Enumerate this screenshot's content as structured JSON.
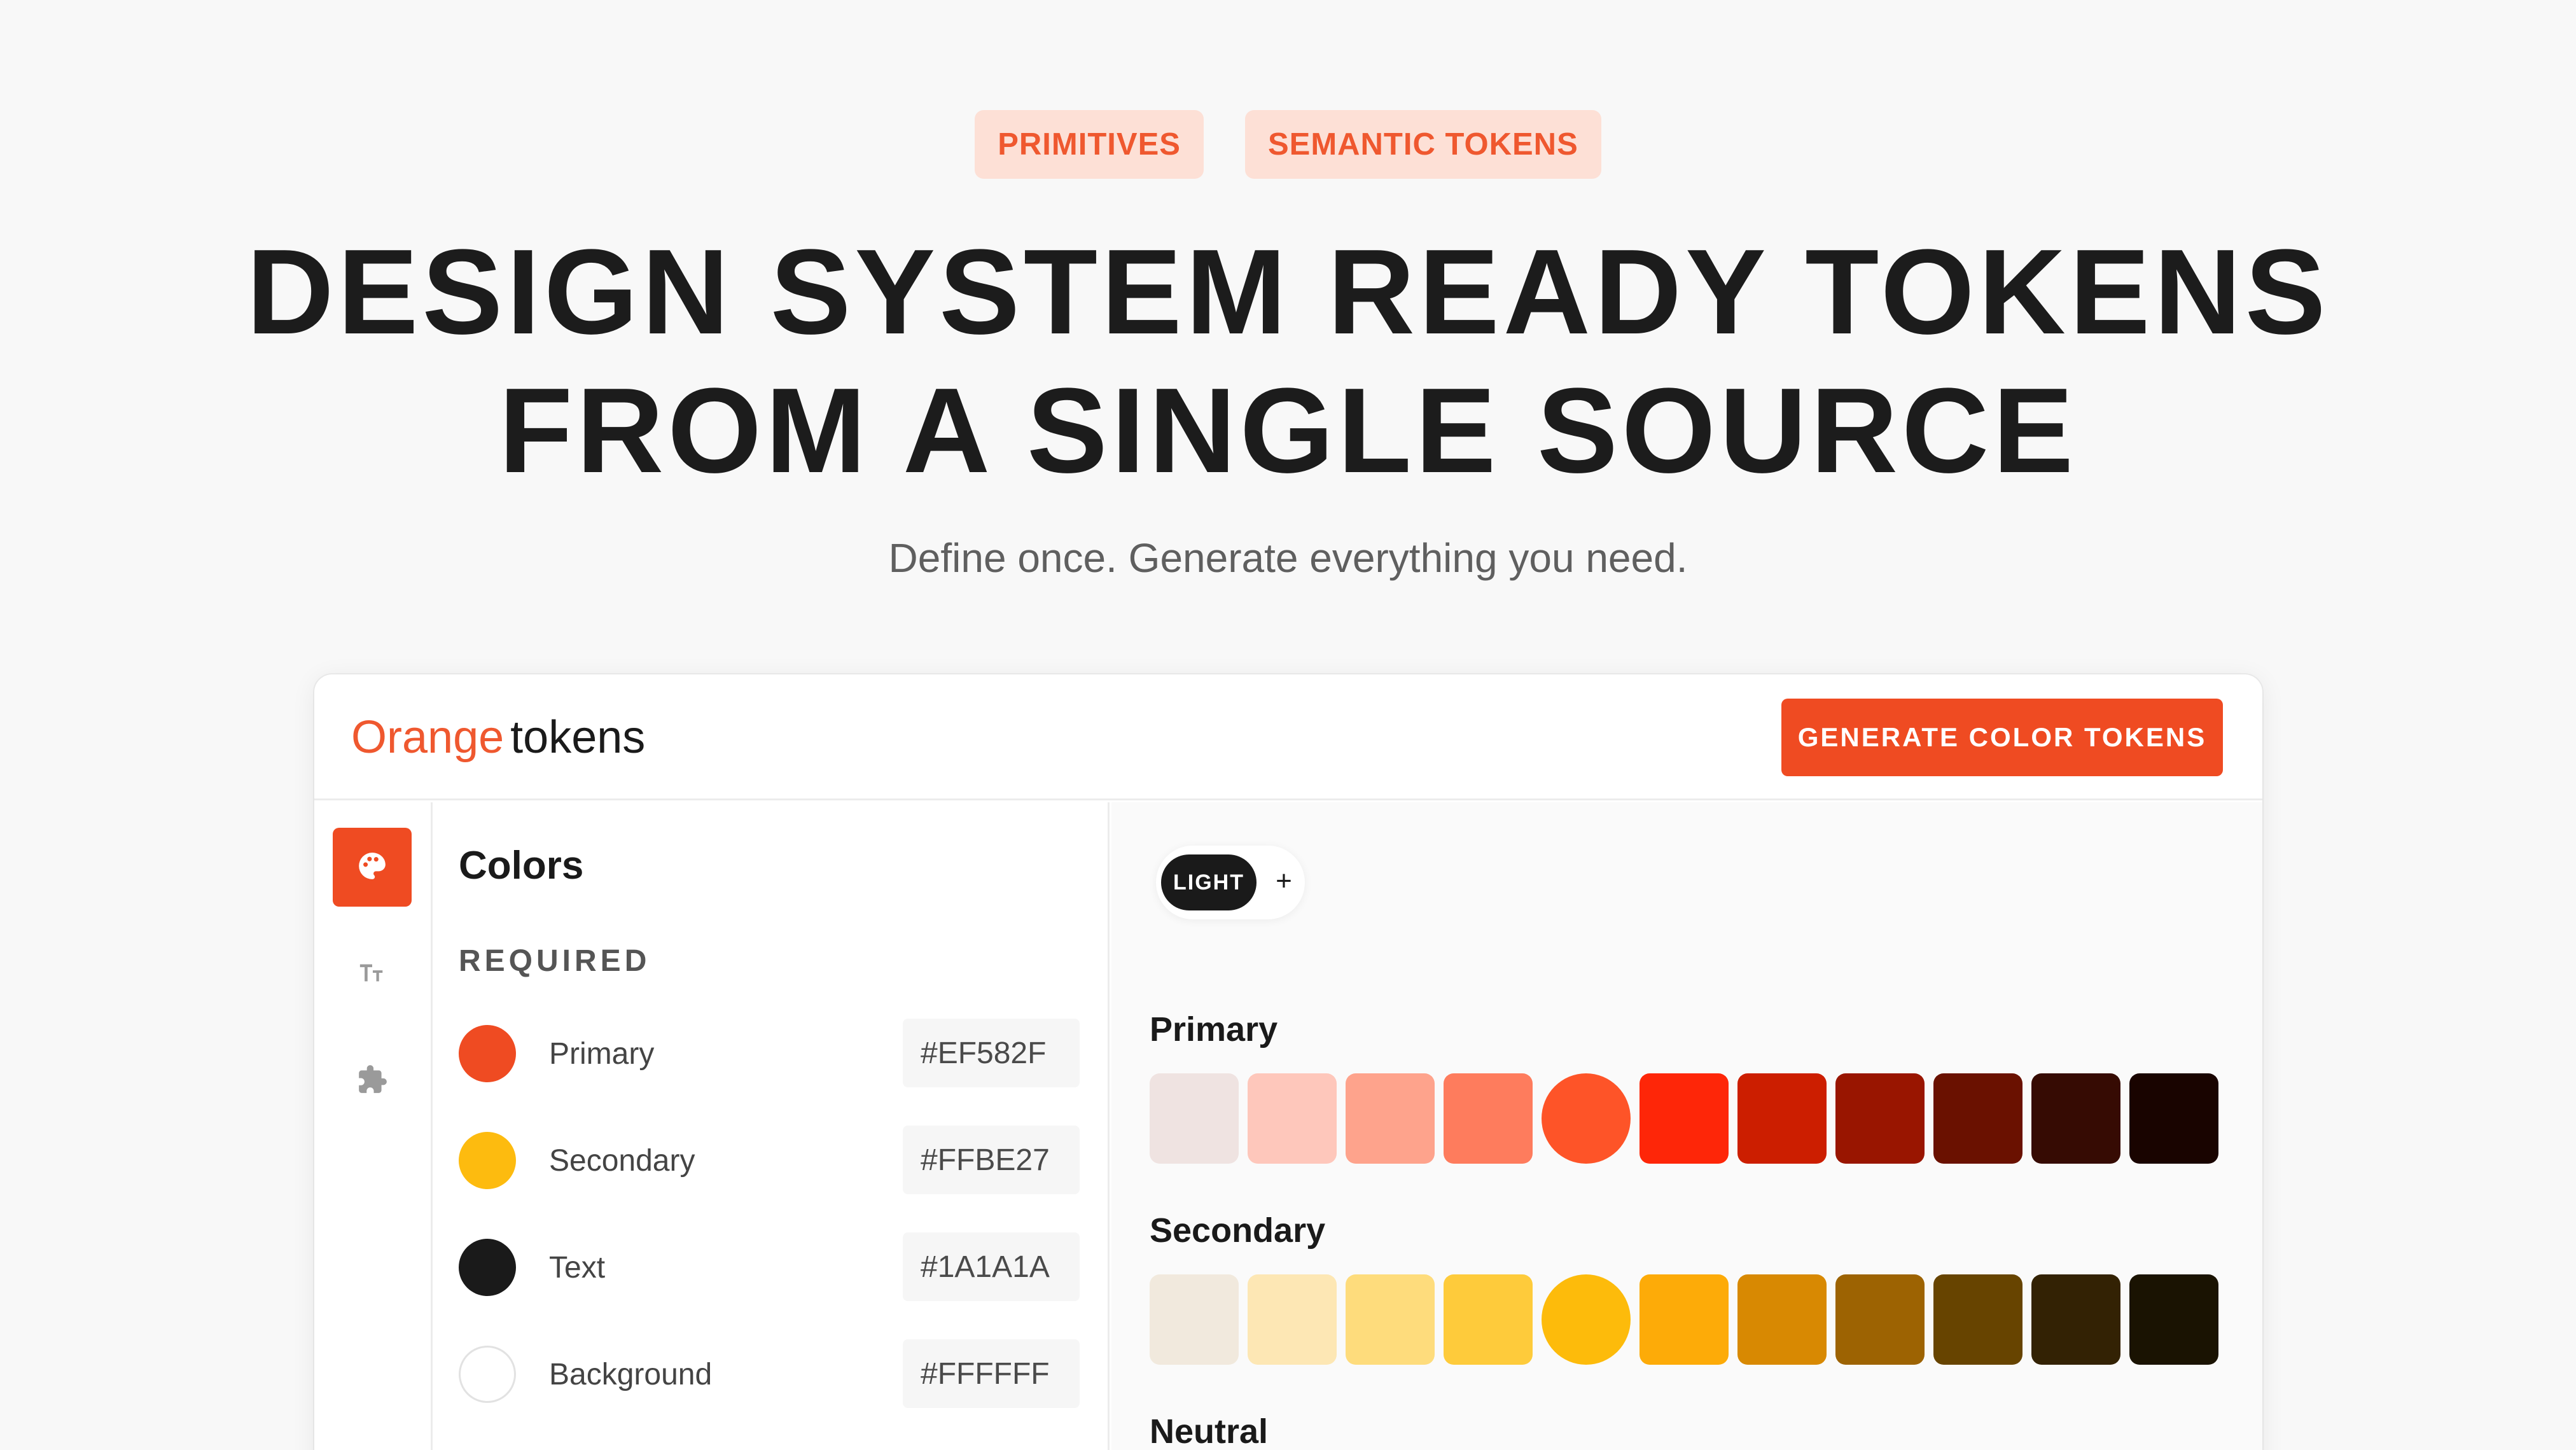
{
  "hero": {
    "pills": [
      "PRIMITIVES",
      "SEMANTIC TOKENS"
    ],
    "headline_line1": "DESIGN SYSTEM READY TOKENS",
    "headline_line2": "FROM A SINGLE SOURCE",
    "subhead": "Define once. Generate everything you need."
  },
  "app": {
    "logo": {
      "brand": "Orange",
      "suffix": "tokens"
    },
    "generate_button": "GENERATE COLOR TOKENS",
    "rail": {
      "items": [
        {
          "icon": "palette-icon",
          "active": true
        },
        {
          "icon": "typography-icon",
          "active": false
        },
        {
          "icon": "puzzle-icon",
          "active": false
        }
      ]
    },
    "panel": {
      "title": "Colors",
      "section_label": "REQUIRED",
      "colors": [
        {
          "name": "Primary",
          "hex": "#EF582F",
          "swatch": "#ef4b22"
        },
        {
          "name": "Secondary",
          "hex": "#FFBE27",
          "swatch": "#fdbb0f"
        },
        {
          "name": "Text",
          "hex": "#1A1A1A",
          "swatch": "#1a1a1a"
        },
        {
          "name": "Background",
          "hex": "#FFFFFF",
          "swatch": "#ffffff"
        }
      ]
    },
    "preview": {
      "mode_active": "LIGHT",
      "mode_add": "+",
      "scales": [
        {
          "name": "Primary",
          "base_index": 4,
          "swatches": [
            "#efe3e1",
            "#fec7bb",
            "#fea38c",
            "#fe7c5d",
            "#fe5428",
            "#fe2608",
            "#cc1e00",
            "#991500",
            "#6a1100",
            "#360b03",
            "#190400"
          ]
        },
        {
          "name": "Secondary",
          "base_index": 4,
          "swatches": [
            "#f1e9dd",
            "#fde7b4",
            "#fedc7c",
            "#fecb3b",
            "#fdbb0b",
            "#fdab08",
            "#d88902",
            "#9d6302",
            "#674400",
            "#332204",
            "#1a1302"
          ]
        },
        {
          "name": "Neutral",
          "base_index": 4,
          "swatches": []
        }
      ]
    }
  },
  "colors": {
    "accent": "#EF582F",
    "pill_bg": "#FDE0D6",
    "text": "#1A1A1A"
  }
}
